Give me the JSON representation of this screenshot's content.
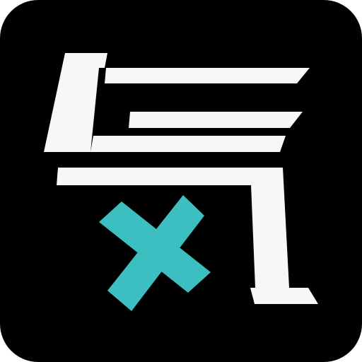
{
  "icon": {
    "name": "qi-x-app-icon",
    "glyph": "気",
    "colors": {
      "background": "#000000",
      "glyph": "#f7f7f7",
      "accent": "#3dbfc1"
    }
  }
}
